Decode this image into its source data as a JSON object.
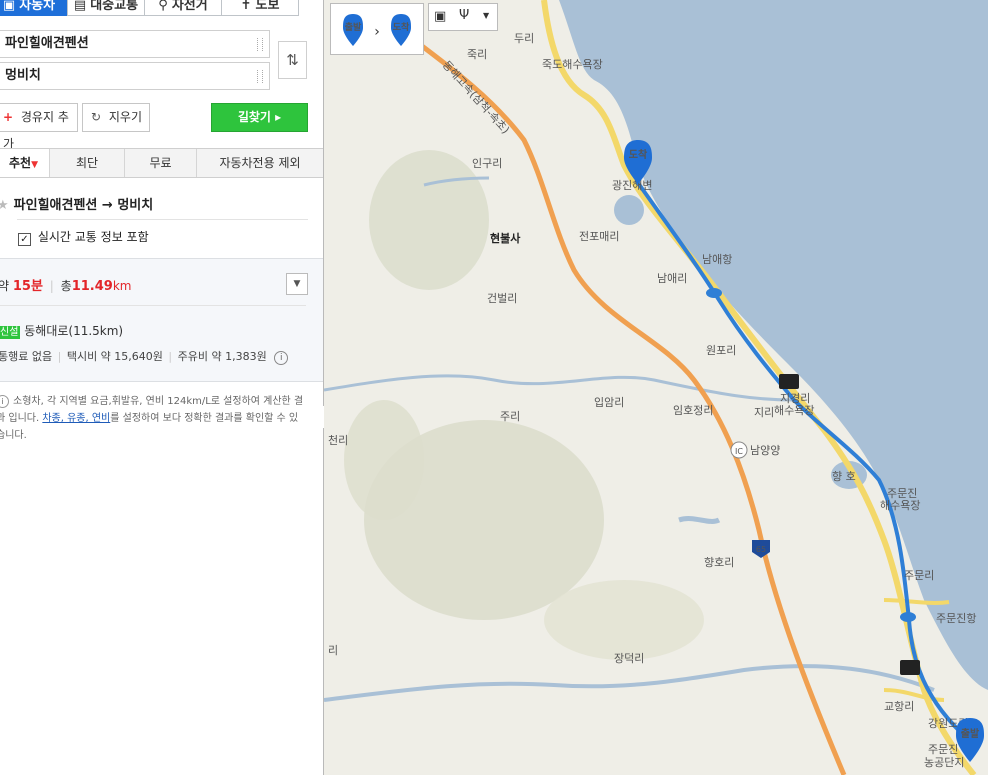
{
  "modes": [
    {
      "label": "자동차",
      "active": true
    },
    {
      "label": "대중교통",
      "active": false
    },
    {
      "label": "자전거",
      "active": false
    },
    {
      "label": "도보",
      "active": false
    }
  ],
  "route_inputs": {
    "origin": "파인힐애견펜션",
    "destination": "멍비치"
  },
  "actions": {
    "waypoint": "경유지 추가",
    "clear": "지우기",
    "search": "길찾기"
  },
  "route_tabs": [
    "추천",
    "최단",
    "무료",
    "자동차전용 제외"
  ],
  "route": {
    "title": "파인힐애견펜션 → 멍비치",
    "traffic_option": "실시간 교통 정보 포함",
    "time_prefix": "약",
    "time": "15분",
    "dist_prefix": "총",
    "distance": "11.49",
    "distance_unit": "km",
    "road_badge": "신설",
    "road": "동해대로(11.5km)",
    "toll": "통행료 없음",
    "taxi": "택시비 약 15,640원",
    "fuel": "주유비 약 1,383원",
    "notice_pre": "소형차, 각 지역별 요금,휘발유, 연비 124km/L로 설정하여 계산한 결과 입니다. ",
    "notice_link": "차종, 유종, 연비",
    "notice_post": "를 설정하여 보다 정확한 결과를 확인할 수 있습니다."
  },
  "map": {
    "start_marker": "출발",
    "end_marker": "도착",
    "highway_name": "동해고속(삼척-속초)",
    "ic_label": "남양양",
    "ic_badge": "IC",
    "route_shield": "65",
    "places": {
      "jukri": "죽리",
      "duri": "두리",
      "jukdo_beach": "죽도해수욕장",
      "ingu": "인구리",
      "gwangjin": "광진해변",
      "hyeonbulsa": "현불사",
      "jeonpo": "전포매리",
      "namae_port": "남애항",
      "namae": "남애리",
      "geonbeol": "건벌리",
      "wonpo": "원포리",
      "ilamri": "입암리",
      "juri": "주리",
      "jigyeong": "지경리",
      "jigyeong_beach": "해수욕장",
      "jiri": "지리",
      "imho": "임호정리",
      "hyangho_lake": "향 호",
      "jumunjin_beach": "주문진",
      "jumunjin_beach2": "해수욕장",
      "hyangho": "향호리",
      "jumun": "주문리",
      "jumunjin_port": "주문진항",
      "jangdeok": "장덕리",
      "gyohang": "교항리",
      "gangwon": "강원도립",
      "jumunjin_farm": "주문진",
      "jumunjin_farm2": "농공단지",
      "edge_left1": "천리",
      "edge_left2": "리"
    },
    "colors": {
      "sea": "#a9c0d6",
      "land": "#efeee7",
      "route": "#2f7fd6",
      "highway": "#f0a050",
      "coastal_road": "#f3d86a"
    }
  }
}
